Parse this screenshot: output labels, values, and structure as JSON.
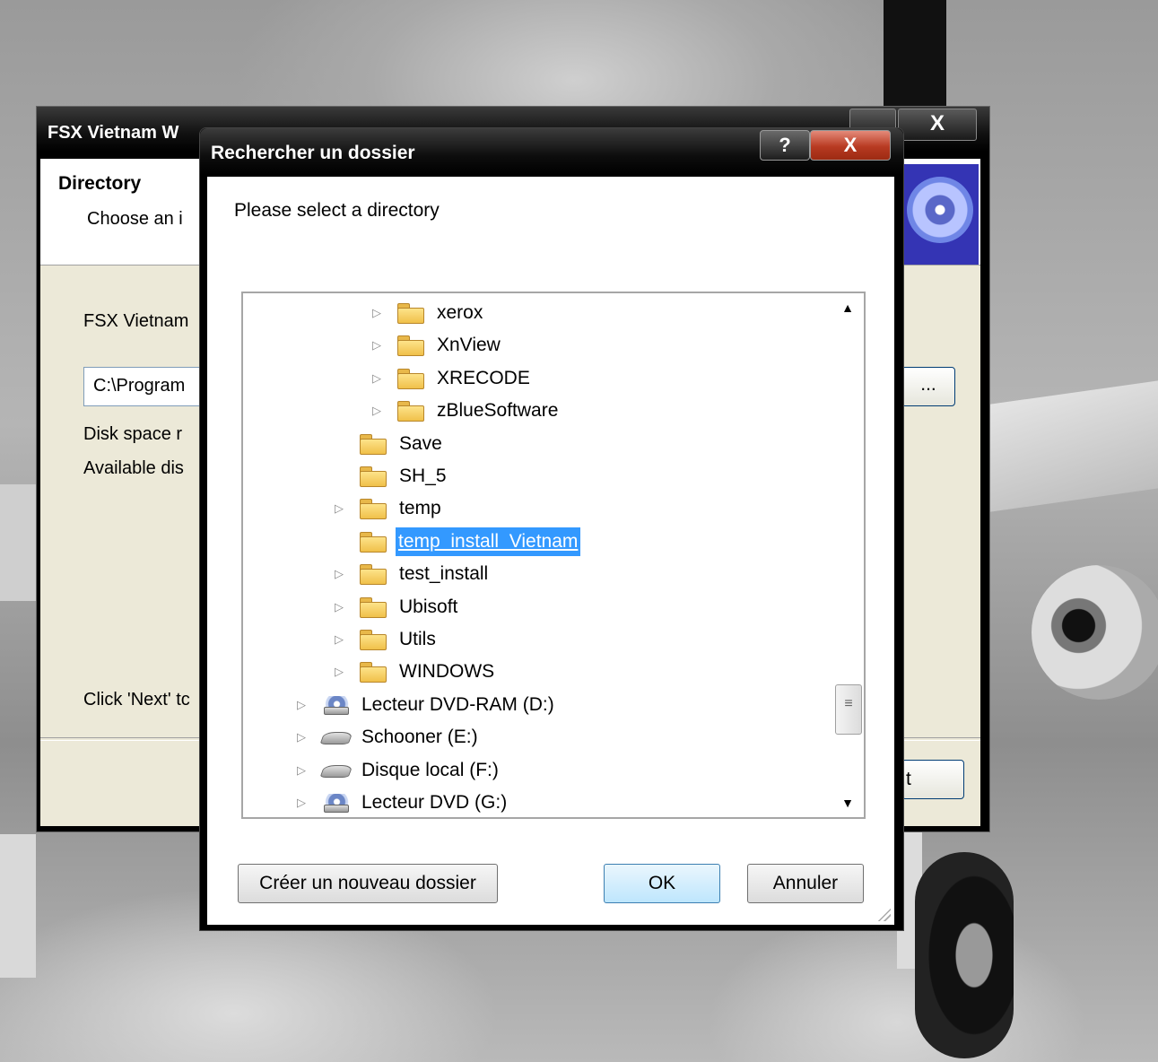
{
  "main_window": {
    "title": "FSX Vietnam W",
    "close_label": "X",
    "heading": "Directory",
    "subheading": "Choose an i",
    "line1": "FSX Vietnam",
    "path_value": "C:\\Program",
    "browse_label": "...",
    "disk_space": "Disk space r",
    "available": "Available dis",
    "next_hint": "Click 'Next' tc",
    "next_label": "t"
  },
  "dialog": {
    "title": "Rechercher un dossier",
    "help_label": "?",
    "close_label": "X",
    "prompt": "Please select a directory",
    "tree": [
      {
        "label": "xerox",
        "expandable": true,
        "icon": "folder-icon"
      },
      {
        "label": "XnView",
        "expandable": true,
        "icon": "folder-icon"
      },
      {
        "label": "XRECODE",
        "expandable": true,
        "icon": "folder-icon"
      },
      {
        "label": "zBlueSoftware",
        "expandable": true,
        "icon": "folder-icon"
      },
      {
        "label": "Save",
        "expandable": false,
        "icon": "folder-icon"
      },
      {
        "label": "SH_5",
        "expandable": false,
        "icon": "folder-icon"
      },
      {
        "label": "temp",
        "expandable": true,
        "icon": "folder-icon"
      },
      {
        "label": "temp_install_Vietnam",
        "expandable": false,
        "icon": "folder-icon",
        "selected": true
      },
      {
        "label": "test_install",
        "expandable": true,
        "icon": "folder-icon"
      },
      {
        "label": "Ubisoft",
        "expandable": true,
        "icon": "folder-icon"
      },
      {
        "label": "Utils",
        "expandable": true,
        "icon": "folder-icon"
      },
      {
        "label": "WINDOWS",
        "expandable": true,
        "icon": "folder-icon"
      },
      {
        "label": "Lecteur DVD-RAM (D:)",
        "expandable": true,
        "icon": "dvd-drive-icon"
      },
      {
        "label": "Schooner (E:)",
        "expandable": true,
        "icon": "hard-drive-icon"
      },
      {
        "label": "Disque local (F:)",
        "expandable": true,
        "icon": "hard-drive-icon"
      },
      {
        "label": "Lecteur DVD (G:)",
        "expandable": true,
        "icon": "dvd-drive-icon"
      }
    ],
    "buttons": {
      "new_folder": "Créer un nouveau dossier",
      "ok": "OK",
      "cancel": "Annuler"
    }
  }
}
